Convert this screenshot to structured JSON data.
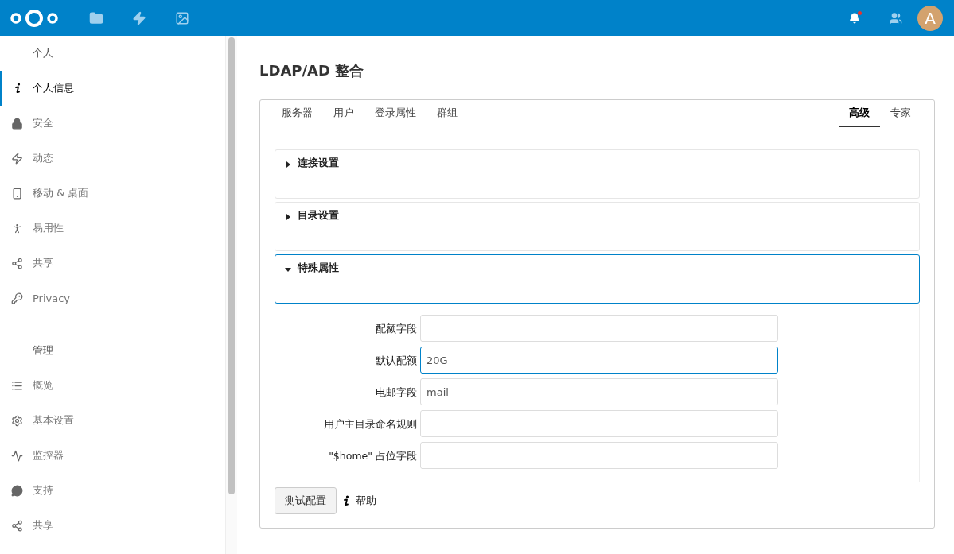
{
  "header": {
    "avatar_letter": "A",
    "notification": true
  },
  "sidebar": {
    "groups": [
      {
        "heading": "个人",
        "items": [
          {
            "label": "个人信息",
            "selected": true
          },
          {
            "label": "安全",
            "selected": false
          },
          {
            "label": "动态",
            "selected": false
          },
          {
            "label": "移动 & 桌面",
            "selected": false
          },
          {
            "label": "易用性",
            "selected": false
          },
          {
            "label": "共享",
            "selected": false
          },
          {
            "label": "Privacy",
            "selected": false
          }
        ]
      },
      {
        "heading": "管理",
        "items": [
          {
            "label": "概览",
            "selected": false
          },
          {
            "label": "基本设置",
            "selected": false
          },
          {
            "label": "监控器",
            "selected": false
          },
          {
            "label": "支持",
            "selected": false
          },
          {
            "label": "共享",
            "selected": false
          }
        ]
      }
    ]
  },
  "page_title": "LDAP/AD 整合",
  "tabs_left": [
    {
      "label": "服务器",
      "selected": false
    },
    {
      "label": "用户",
      "selected": false
    },
    {
      "label": "登录属性",
      "selected": false
    },
    {
      "label": "群组",
      "selected": false
    }
  ],
  "tabs_right": [
    {
      "label": "高级",
      "selected": true
    },
    {
      "label": "专家",
      "selected": false
    }
  ],
  "sections": [
    {
      "title": "连接设置",
      "expanded": false
    },
    {
      "title": "目录设置",
      "expanded": false
    },
    {
      "title": "特殊属性",
      "expanded": true,
      "fields": [
        {
          "label": "配额字段",
          "focused": false
        },
        {
          "label": "默认配额",
          "value": "20G",
          "focused": true
        },
        {
          "label": "电邮字段",
          "value": "mail",
          "focused": false
        },
        {
          "label": "用户主目录命名规则",
          "focused": false
        },
        {
          "label": "\"$home\" 占位字段",
          "focused": false
        }
      ]
    }
  ],
  "test_button": "测试配置",
  "help_link": "帮助"
}
